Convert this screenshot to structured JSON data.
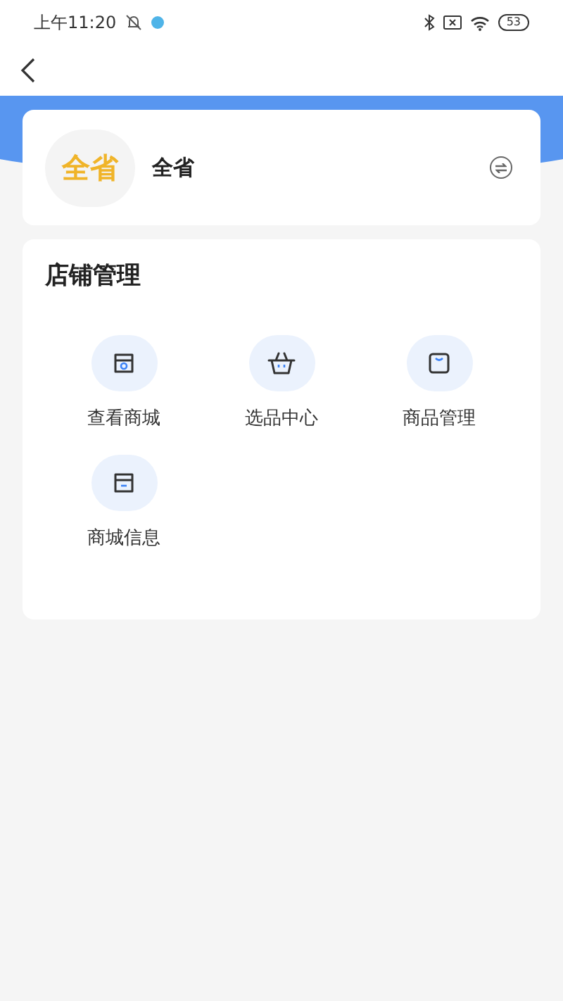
{
  "status_bar": {
    "time": "上午11:20",
    "battery": "53"
  },
  "store": {
    "avatar_text": "全省",
    "name": "全省"
  },
  "section": {
    "title": "店铺管理",
    "items": [
      {
        "kind": "store-search",
        "label": "查看商城"
      },
      {
        "kind": "basket",
        "label": "选品中心"
      },
      {
        "kind": "bag",
        "label": "商品管理"
      },
      {
        "kind": "store-info",
        "label": "商城信息"
      }
    ]
  }
}
